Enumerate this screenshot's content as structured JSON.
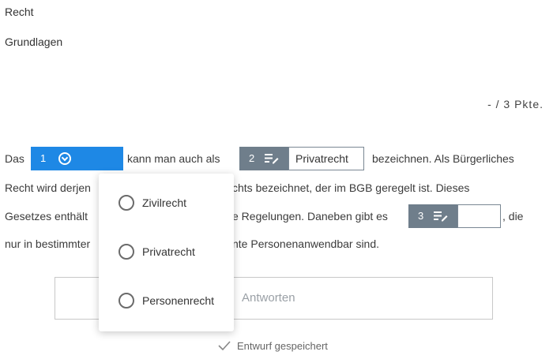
{
  "breadcrumb": {
    "subject": "Recht",
    "topic": "Grundlagen"
  },
  "points": {
    "text": "- / 3 Pkte."
  },
  "text": {
    "l1_a": "Das",
    "l1_b": "kann man auch als",
    "l1_c": "bezeichnen. Als Bürgerliches",
    "l2_a": "Recht wird derjen",
    "l2_b": "chts bezeichnet, der im BGB geregelt ist. Dieses",
    "l3_a": "Gesetzes enthält",
    "l3_b": "e Regelungen. Daneben gibt es",
    "l3_c": ", die",
    "l4_a": "nur in bestimmter",
    "l4_b": "nte Personenanwendbar sind."
  },
  "gaps": [
    {
      "number": "1",
      "type": "dropdown",
      "value": ""
    },
    {
      "number": "2",
      "type": "text",
      "value": "Privatrecht"
    },
    {
      "number": "3",
      "type": "text",
      "value": ""
    }
  ],
  "dropdown": {
    "options": [
      "Zivilrecht",
      "Privatrecht",
      "Personenrecht"
    ]
  },
  "answer": {
    "label": "Antworten"
  },
  "status": {
    "saved": "Entwurf gespeichert"
  },
  "colors": {
    "accent": "#1e88e5",
    "gap_grey": "#6f7e8b"
  }
}
